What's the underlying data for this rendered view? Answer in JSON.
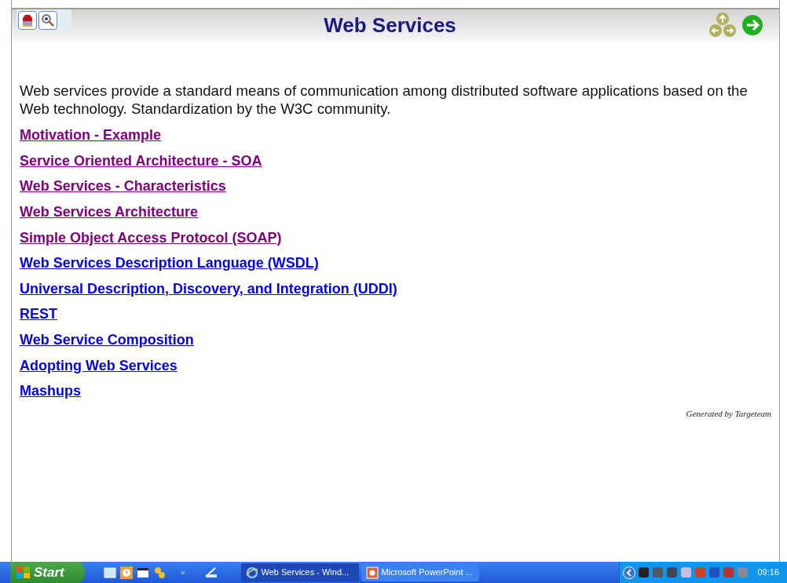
{
  "header": {
    "title": "Web Services"
  },
  "intro": "Web services provide a standard means of communication among distributed software applications based on the Web technology. Standardization by the W3C community.",
  "links": [
    {
      "label": "Motivation - Example",
      "visited": true
    },
    {
      "label": "Service Oriented Architecture - SOA",
      "visited": true
    },
    {
      "label": "Web Services - Characteristics",
      "visited": true
    },
    {
      "label": "Web Services Architecture",
      "visited": true
    },
    {
      "label": "Simple Object Access Protocol (SOAP)",
      "visited": true
    },
    {
      "label": "Web Services Description Language (WSDL)",
      "visited": false
    },
    {
      "label": "Universal Description, Discovery, and Integration (UDDI)",
      "visited": false
    },
    {
      "label": "REST",
      "visited": false
    },
    {
      "label": "Web Service Composition",
      "visited": false
    },
    {
      "label": "Adopting Web Services",
      "visited": false
    },
    {
      "label": "Mashups",
      "visited": false
    }
  ],
  "footer": "Generated by Targeteam",
  "taskbar": {
    "start": "Start",
    "quicklaunch_more": "»",
    "tasks": [
      {
        "label": "Web Services - Wind...",
        "kind": "browser",
        "selected": true
      },
      {
        "label": "Microsoft PowerPoint ...",
        "kind": "slides",
        "selected": false
      }
    ],
    "clock": "09:16"
  }
}
